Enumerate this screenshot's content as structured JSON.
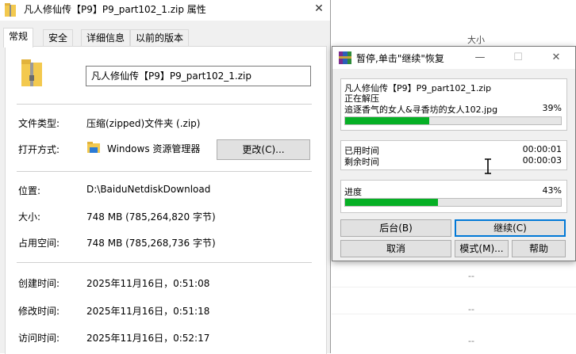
{
  "background": {
    "column_header": "大小",
    "dashes": [
      "--",
      "--",
      "--"
    ]
  },
  "properties": {
    "title": "凡人修仙传【P9】P9_part102_1.zip 属性",
    "tabs": [
      "常规",
      "安全",
      "详细信息",
      "以前的版本"
    ],
    "file_name": "凡人修仙传【P9】P9_part102_1.zip",
    "rows": {
      "type_label": "文件类型:",
      "type_value": "压缩(zipped)文件夹 (.zip)",
      "open_label": "打开方式:",
      "open_value": "Windows 资源管理器",
      "change_button": "更改(C)...",
      "location_label": "位置:",
      "location_value": "D:\\BaiduNetdiskDownload",
      "size_label": "大小:",
      "size_value": "748 MB (785,264,820 字节)",
      "disk_label": "占用空间:",
      "disk_value": "748 MB (785,268,736 字节)",
      "created_label": "创建时间:",
      "created_value": "2025年11月16日，0:51:08",
      "modified_label": "修改时间:",
      "modified_value": "2025年11月16日，0:51:18",
      "accessed_label": "访问时间:",
      "accessed_value": "2025年11月16日，0:52:17"
    }
  },
  "rar": {
    "title": "暂停,单击\"继续\"恢复",
    "archive": "凡人修仙传【P9】P9_part102_1.zip",
    "status": "正在解压",
    "current_file": "追逐香气的女人&寻香坊的女人102.jpg",
    "file_percent_text": "39%",
    "file_progress": 0.39,
    "elapsed_label": "已用时间",
    "elapsed_value": "00:00:01",
    "remaining_label": "剩余时间",
    "remaining_value": "00:00:03",
    "total_label": "进度",
    "total_percent_text": "43%",
    "total_progress": 0.43,
    "buttons": {
      "background": "后台(B)",
      "continue": "继续(C)",
      "cancel": "取消",
      "mode": "模式(M)...",
      "help": "帮助"
    },
    "progress_color": "#06b025"
  }
}
